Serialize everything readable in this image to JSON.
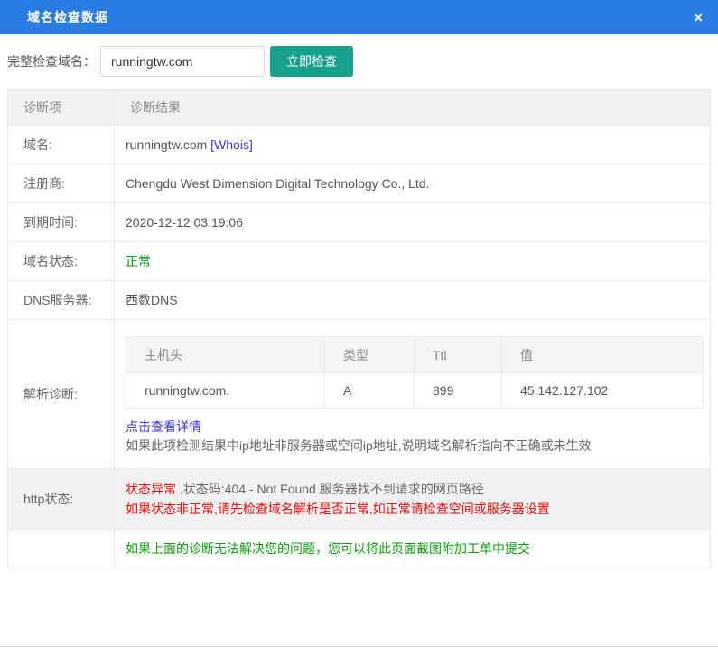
{
  "modal": {
    "title": "域名检查数据",
    "close_icon": "×"
  },
  "search": {
    "label": "完整检查域名：",
    "input_value": "runningtw.com",
    "button_label": "立即检查"
  },
  "table": {
    "headers": [
      "诊断项",
      "诊断结果"
    ],
    "rows": {
      "domain": {
        "label": "域名:",
        "value": "runningtw.com",
        "whois_link": "[Whois]"
      },
      "registrar": {
        "label": "注册商:",
        "value": "Chengdu West Dimension Digital Technology Co., Ltd."
      },
      "expiry": {
        "label": "到期时间:",
        "value": "2020-12-12 03:19:06"
      },
      "domain_status": {
        "label": "域名状态:",
        "value": "正常"
      },
      "dns_server": {
        "label": "DNS服务器:",
        "value": "西数DNS"
      },
      "resolution": {
        "label": "解析诊断:",
        "dns_table": {
          "headers": [
            "主机头",
            "类型",
            "Ttl",
            "值"
          ],
          "rows": [
            [
              "runningtw.com.",
              "A",
              "899",
              "45.142.127.102"
            ]
          ]
        },
        "detail_link": "点击查看详情",
        "note": "如果此项检测结果中ip地址非服务器或空间ip地址,说明域名解析指向不正确或未生效"
      },
      "http_status": {
        "label": "http状态:",
        "status_text": "状态异常",
        "status_detail": " ,状态码:404 - Not Found 服务器找不到请求的网页路径",
        "warning": "如果状态非正常,请先检查域名解析是否正常,如正常请检查空间或服务器设置"
      },
      "footer_note": "如果上面的诊断无法解决您的问题，您可以将此页面截图附加工单中提交"
    }
  },
  "colors": {
    "header_bg": "#2b7ce2",
    "button_bg": "#18a08c",
    "link_blue": "#3a3ad9",
    "success_green": "#0a9e0a",
    "error_red": "#ee0a0a"
  }
}
